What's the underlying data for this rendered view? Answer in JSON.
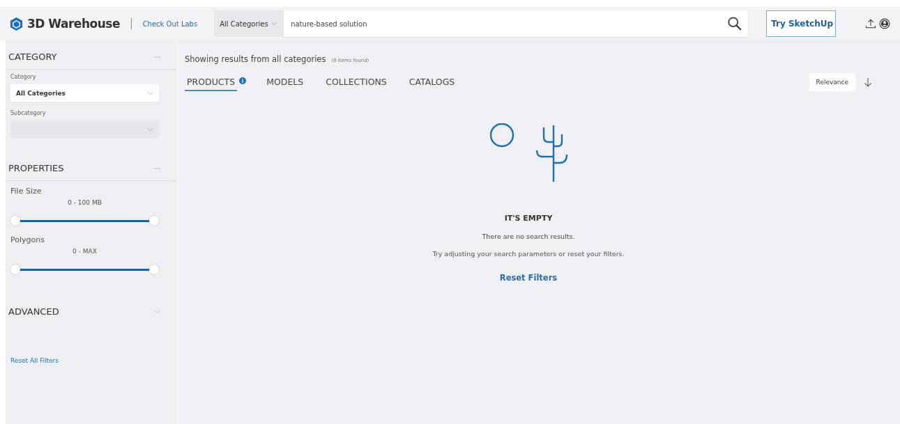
{
  "header": {
    "logo": "3D Warehouse",
    "labs_link": "Check Out Labs",
    "search": {
      "category": "All Categories",
      "value": "nature-based solution"
    },
    "try_button": "Try SketchUp"
  },
  "sidebar": {
    "sections": [
      {
        "kind": "category",
        "title": "CATEGORY",
        "expanded": true,
        "fields": [
          {
            "label": "Category",
            "value": "All Categories",
            "disabled": false
          },
          {
            "label": "Subcategory",
            "disabled": true
          }
        ]
      },
      {
        "kind": "properties",
        "title": "PROPERTIES",
        "expanded": true,
        "sliders": [
          {
            "label": "File Size",
            "reading": "0 - 100 MB",
            "level": 1
          },
          {
            "label": "Polygons",
            "reading": "0 - MAX",
            "level": 1
          }
        ]
      },
      {
        "kind": "advanced",
        "title": "ADVANCED",
        "expanded": false
      }
    ],
    "reset_link": "Reset All Filters"
  },
  "main": {
    "summary": "Showing results from all categories",
    "count": "(0 items found)",
    "tabs": [
      {
        "label": "PRODUCTS",
        "selected": true,
        "info": true
      },
      {
        "label": "MODELS",
        "selected": false,
        "info": false
      },
      {
        "label": "COLLECTIONS",
        "selected": false,
        "info": false
      },
      {
        "label": "CATALOGS",
        "selected": false,
        "info": false
      }
    ],
    "sort": "Relevance",
    "empty": {
      "title": "IT'S EMPTY",
      "message": "There are no search results.",
      "hint": "Try adjusting your search parameters or reset your filters.",
      "reset_link": "Reset Filters"
    }
  }
}
